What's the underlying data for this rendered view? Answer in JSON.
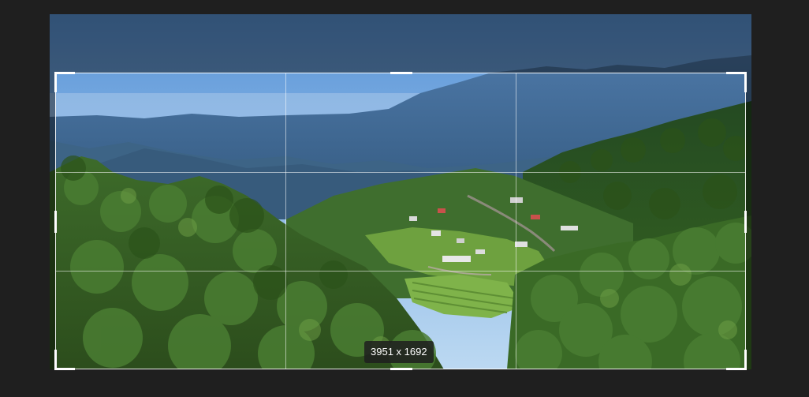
{
  "crop_overlay": {
    "dimensions_label": "3951 x 1692"
  },
  "photo": {
    "subject": "mountain-valley-landscape"
  },
  "colors": {
    "background": "#1f1f1f",
    "crop_border": "#ffffff",
    "sky": "#7fb6e8",
    "mountains": "#3f6a98",
    "forest": "#2f5a1f"
  }
}
